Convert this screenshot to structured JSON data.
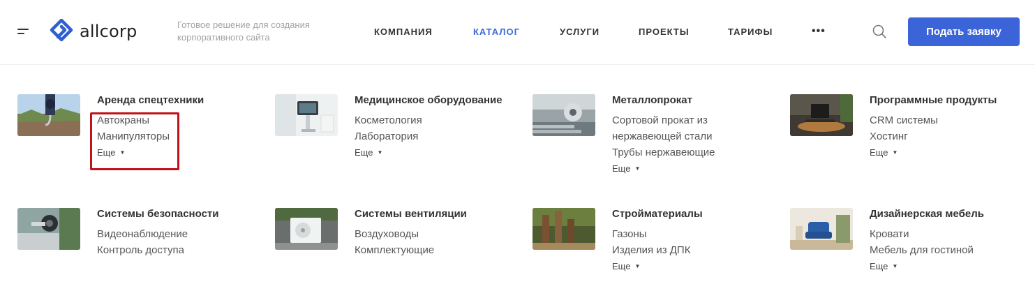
{
  "header": {
    "logo_text": "allcorp",
    "tagline": "Готовое решение для создания корпоративного сайта",
    "nav": [
      {
        "label": "КОМПАНИЯ",
        "active": false
      },
      {
        "label": "КАТАЛОГ",
        "active": true
      },
      {
        "label": "УСЛУГИ",
        "active": false
      },
      {
        "label": "ПРОЕКТЫ",
        "active": false
      },
      {
        "label": "ТАРИФЫ",
        "active": false
      }
    ],
    "more_dots": "•••",
    "cta_label": "Подать заявку",
    "icons": {
      "menu": "hamburger-icon",
      "search": "search-icon",
      "logo": "allcorp-logo-icon"
    }
  },
  "colors": {
    "accent": "#3b64d8",
    "nav_active": "#3a6bd6",
    "highlight": "#c1121a"
  },
  "catalog": [
    {
      "title": "Аренда спецтехники",
      "links": [
        "Автокраны",
        "Манипуляторы"
      ],
      "more": "Еще",
      "image": "crane-hook-photo"
    },
    {
      "title": "Медицинское оборудование",
      "links": [
        "Косметология",
        "Лаборатория"
      ],
      "more": "Еще",
      "image": "medical-device-photo"
    },
    {
      "title": "Металлопрокат",
      "links": [
        "Сортовой прокат из нержавеющей стали",
        "Трубы нержавеющие"
      ],
      "more": "Еще",
      "image": "steel-pipes-photo"
    },
    {
      "title": "Программные продукты",
      "links": [
        "CRM системы",
        "Хостинг"
      ],
      "more": "Еще",
      "image": "laptop-photo"
    },
    {
      "title": "Системы безопасности",
      "links": [
        "Видеонаблюдение",
        "Контроль доступа"
      ],
      "more": "",
      "image": "cctv-camera-photo"
    },
    {
      "title": "Системы вентиляции",
      "links": [
        "Воздуховоды",
        "Комплектующие"
      ],
      "more": "",
      "image": "ac-unit-photo"
    },
    {
      "title": "Стройматериалы",
      "links": [
        "Газоны",
        "Изделия из ДПК"
      ],
      "more": "Еще",
      "image": "wood-posts-photo"
    },
    {
      "title": "Дизайнерская мебель",
      "links": [
        "Кровати",
        "Мебель для гостиной"
      ],
      "more": "Еще",
      "image": "armchair-photo"
    }
  ]
}
